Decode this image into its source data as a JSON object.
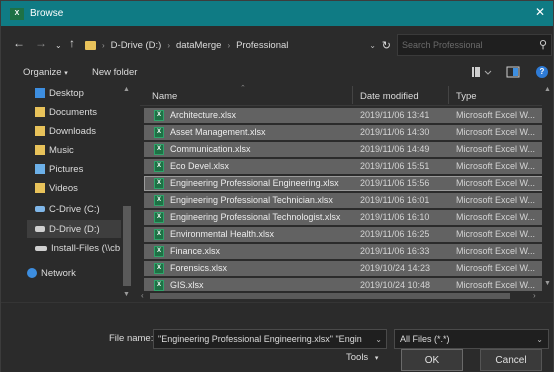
{
  "window": {
    "title": "Browse",
    "app_icon": "excel-icon"
  },
  "nav": {
    "breadcrumb": [
      "D-Drive (D:)",
      "dataMerge",
      "Professional"
    ],
    "search_placeholder": "Search Professional"
  },
  "toolbar": {
    "organize": "Organize",
    "new_folder": "New folder"
  },
  "sidebar": {
    "items": [
      {
        "label": "Desktop",
        "icon": "desktop-folder-icon",
        "color": "#3d8ee0"
      },
      {
        "label": "Documents",
        "icon": "documents-folder-icon",
        "color": "#e8c25a"
      },
      {
        "label": "Downloads",
        "icon": "downloads-folder-icon",
        "color": "#e8c25a"
      },
      {
        "label": "Music",
        "icon": "music-folder-icon",
        "color": "#e8c25a"
      },
      {
        "label": "Pictures",
        "icon": "pictures-folder-icon",
        "color": "#6cb0e8"
      },
      {
        "label": "Videos",
        "icon": "videos-folder-icon",
        "color": "#e8c25a"
      },
      {
        "label": "C-Drive (C:)",
        "icon": "drive-icon",
        "color": "#7fb6e8"
      },
      {
        "label": "D-Drive (D:)",
        "icon": "drive-icon",
        "color": "#cfcfcf"
      },
      {
        "label": "Install-Files (\\\\cb",
        "icon": "network-drive-icon",
        "color": "#cfcfcf"
      },
      {
        "label": "Network",
        "icon": "network-icon",
        "color": "#3d8ee0"
      }
    ],
    "selected_index": 7
  },
  "columns": {
    "name": "Name",
    "date": "Date modified",
    "type": "Type"
  },
  "files": [
    {
      "name": "Architecture.xlsx",
      "date": "2019/11/06 13:41",
      "type": "Microsoft Excel W..."
    },
    {
      "name": "Asset Management.xlsx",
      "date": "2019/11/06 14:30",
      "type": "Microsoft Excel W..."
    },
    {
      "name": "Communication.xlsx",
      "date": "2019/11/06 14:49",
      "type": "Microsoft Excel W..."
    },
    {
      "name": "Eco Devel.xlsx",
      "date": "2019/11/06 15:51",
      "type": "Microsoft Excel W..."
    },
    {
      "name": "Engineering Professional Engineering.xlsx",
      "date": "2019/11/06 15:56",
      "type": "Microsoft Excel W..."
    },
    {
      "name": "Engineering Professional Technician.xlsx",
      "date": "2019/11/06 16:01",
      "type": "Microsoft Excel W..."
    },
    {
      "name": "Engineering Professional Technologist.xlsx",
      "date": "2019/11/06 16:10",
      "type": "Microsoft Excel W..."
    },
    {
      "name": "Environmental Health.xlsx",
      "date": "2019/11/06 16:25",
      "type": "Microsoft Excel W..."
    },
    {
      "name": "Finance.xlsx",
      "date": "2019/11/06 16:33",
      "type": "Microsoft Excel W..."
    },
    {
      "name": "Forensics.xlsx",
      "date": "2019/10/24 14:23",
      "type": "Microsoft Excel W..."
    },
    {
      "name": "GIS.xlsx",
      "date": "2019/10/24 10:48",
      "type": "Microsoft Excel W..."
    }
  ],
  "focused_row": 4,
  "bottom": {
    "file_name_label": "File name:",
    "file_name_value": "\"Engineering Professional Engineering.xlsx\" \"Engin",
    "filter": "All Files (*.*)",
    "tools": "Tools",
    "ok": "OK",
    "cancel": "Cancel"
  },
  "colors": {
    "title_bar": "#0f7b84",
    "row_selected": "#626262",
    "background": "#2b2b2b"
  }
}
